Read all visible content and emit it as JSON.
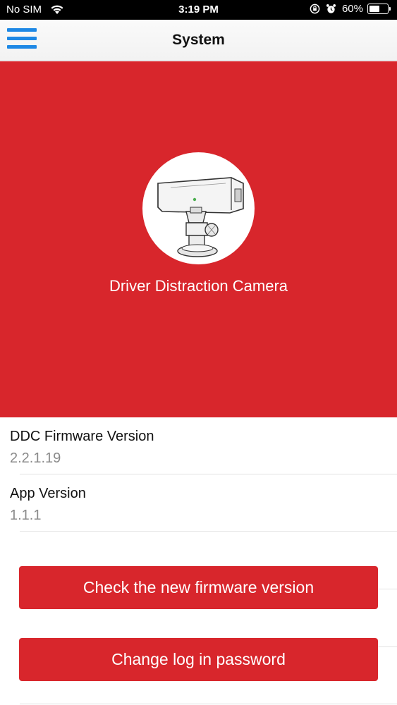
{
  "status_bar": {
    "carrier": "No SIM",
    "time": "3:19 PM",
    "battery_percent": "60%",
    "battery_level": 0.6,
    "icons": [
      "wifi-icon",
      "orientation-lock-icon",
      "alarm-icon",
      "battery-icon"
    ]
  },
  "nav": {
    "title": "System",
    "menu_icon": "hamburger-menu-icon"
  },
  "hero": {
    "device_name": "Driver Distraction Camera",
    "device_image": "camera-device-icon",
    "background_color": "#d8262c"
  },
  "info": {
    "firmware_label": "DDC Firmware Version",
    "firmware_value": "2.2.1.19",
    "app_label": "App Version",
    "app_value": "1.1.1"
  },
  "actions": {
    "check_firmware_label": "Check the new firmware version",
    "change_password_label": "Change log in password",
    "button_color": "#d8262c"
  },
  "colors": {
    "accent": "#1e88e5",
    "primary": "#d8262c"
  }
}
